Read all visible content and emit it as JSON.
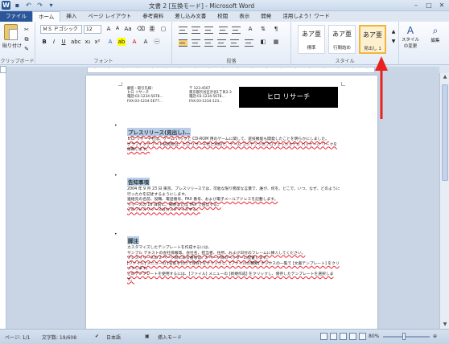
{
  "title": "文書 2 [互換モード] - Microsoft Word",
  "tabs": [
    "ファイル",
    "ホーム",
    "挿入",
    "ページ レイアウト",
    "参考資料",
    "差し込み文書",
    "校閲",
    "表示",
    "開発",
    "活用しよう！ワード"
  ],
  "ribbon": {
    "paste": "貼り付け",
    "clipboard": "クリップボード",
    "font_name": "ＭＳ Ｐゴシック",
    "font_size": "12",
    "font_group": "フォント",
    "paragraph_group": "段落",
    "style_group": "スタイル",
    "styles": [
      {
        "sample": "あア亜",
        "name": "標準"
      },
      {
        "sample": "あア亜",
        "name": "行間詰め"
      },
      {
        "sample": "あア亜",
        "name": "見出し 1"
      }
    ],
    "style_change": "スタイルの変更",
    "edit": "編集",
    "bold": "B",
    "italic": "I",
    "underline": "U"
  },
  "document": {
    "header_left": [
      "顧客・取引先様：",
      "ヒロ リサーチ",
      "電話:03-1234-5678…",
      "FAX:03-1234-5677…"
    ],
    "header_mid": [
      "〒 123-4567",
      "東京都渋谷区渋谷1丁目2-3",
      "電話:03-1234-5678…",
      "FAX:03-1234-123…"
    ],
    "company": "ヒロ リサーチ",
    "sections": [
      {
        "head": "プレスリリース(見出し)…",
        "lines": [
          "ヒロ リサーチ社は、ゲーム パックと CD-ROM 用のゲームに関して、遊技機能も開発したことを明らかにしました。",
          "グラフィック アート研究所は、ヒロ リサーチ社と共同で、ゲーム コンテンツのプロフェッショナル パッケージ ワークを依頼します。"
        ]
      },
      {
        "head": "告知事項",
        "lines": [
          "2004 年 9 月 23 日 東京。プレスリリースでは、可能な限り簡潔な言葉で、誰が、何を、どこで、いつ、なぜ、どのように行ったかを記述するようにします。",
          "連絡先の名前、役職、電話番号、FAX 番号、および電子メールアドレスを記載します。",
          "リリースの 10 日前に、郵便または FAX で送信する。",
          "このプレスリリースはカスタマイズする。"
        ]
      },
      {
        "head": "脚注",
        "lines": [
          "カスタマイズしたテンプレートを作成するには、",
          "サンプル テキストの会社情報等、会社名、担当者、住所、および日付のフレームに挿入してください。",
          "プレスリリースの 2 ページ目にある番号は、2 ページ目のヘッダーに配置します。",
          "[ファイル] メニューの [名前を付けて保存] をクリックし、[ファイルの種類] ボックスの一覧で [文書テンプレート] をクリックします。",
          "このテンプレートを使用するには、[ファイル] メニューの [新規作成] をクリックし、保存したテンプレートを選択します。"
        ]
      }
    ]
  },
  "status": {
    "page": "ページ: 1/1",
    "words": "文字数: 19/608",
    "language": "日本語",
    "mode": "挿入モード",
    "zoom": "80%"
  },
  "colors": {
    "accent": "#2b579a",
    "highlight": "#b9cde8",
    "annotation": "#e8231f"
  }
}
